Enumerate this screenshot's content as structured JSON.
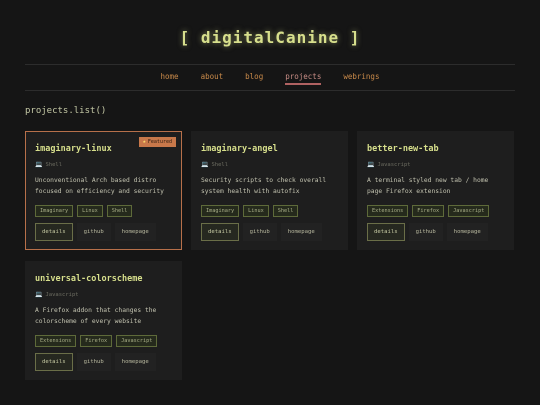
{
  "site": {
    "title": "[ digitalCanine ]"
  },
  "nav": {
    "items": [
      "home",
      "about",
      "blog",
      "projects",
      "webrings"
    ],
    "active": "projects"
  },
  "section": {
    "heading": "projects.list()"
  },
  "badge": {
    "label": "Featured",
    "icon": "star-icon"
  },
  "projects": [
    {
      "name": "imaginary-linux",
      "language": "Shell",
      "description": "Unconventional Arch based distro focused on efficiency and security",
      "tags": [
        "Imaginary",
        "Linux",
        "Shell"
      ],
      "featured": true,
      "actions": [
        "details",
        "github",
        "homepage"
      ]
    },
    {
      "name": "imaginary-angel",
      "language": "Shell",
      "description": "Security scripts to check overall system health with autofix",
      "tags": [
        "Imaginary",
        "Linux",
        "Shell"
      ],
      "featured": false,
      "actions": [
        "details",
        "github",
        "homepage"
      ]
    },
    {
      "name": "better-new-tab",
      "language": "Javascript",
      "description": "A terminal styled new tab / home page Firefox extension",
      "tags": [
        "Extensions",
        "Firefox",
        "Javascript"
      ],
      "featured": false,
      "actions": [
        "details",
        "github",
        "homepage"
      ]
    },
    {
      "name": "universal-colorscheme",
      "language": "Javascript",
      "description": "A Firefox addon that changes the colorscheme of every website",
      "tags": [
        "Extensions",
        "Firefox",
        "Javascript"
      ],
      "featured": false,
      "actions": [
        "details",
        "github",
        "homepage"
      ]
    }
  ],
  "colors": {
    "background": "#151515",
    "card": "#1e1e1e",
    "accent": "#d7df8c",
    "nav_link": "#c98a4a",
    "featured_border": "#b7704a"
  }
}
